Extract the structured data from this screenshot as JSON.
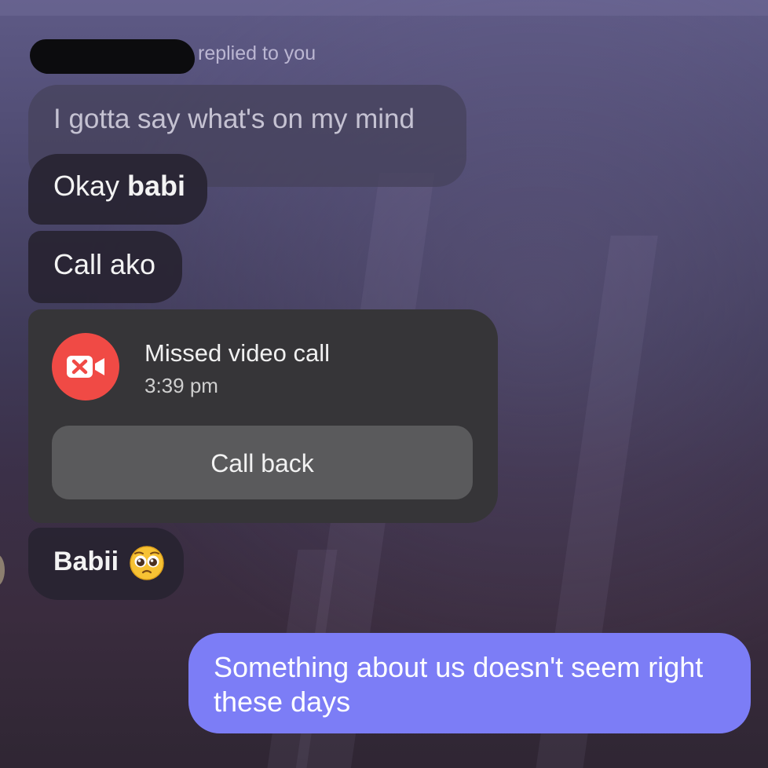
{
  "reply": {
    "header_text": "replied to you",
    "quoted_message": "I gotta say what's on my mind"
  },
  "messages": {
    "okay_prefix": "Okay ",
    "okay_bold": "babi",
    "call_ako": "Call ako",
    "babii": "Babii",
    "sent": "Something about us doesn't seem right these days"
  },
  "missed_call": {
    "title": "Missed video call",
    "time": "3:39 pm",
    "button_label": "Call back",
    "icon": "missed-video-call-icon",
    "icon_color": "#f04a45"
  },
  "emoji": {
    "name": "pleading-face-emoji"
  },
  "colors": {
    "sent_bubble": "#7c7df6",
    "received_bubble": "#28243280",
    "call_card": "#363538"
  }
}
